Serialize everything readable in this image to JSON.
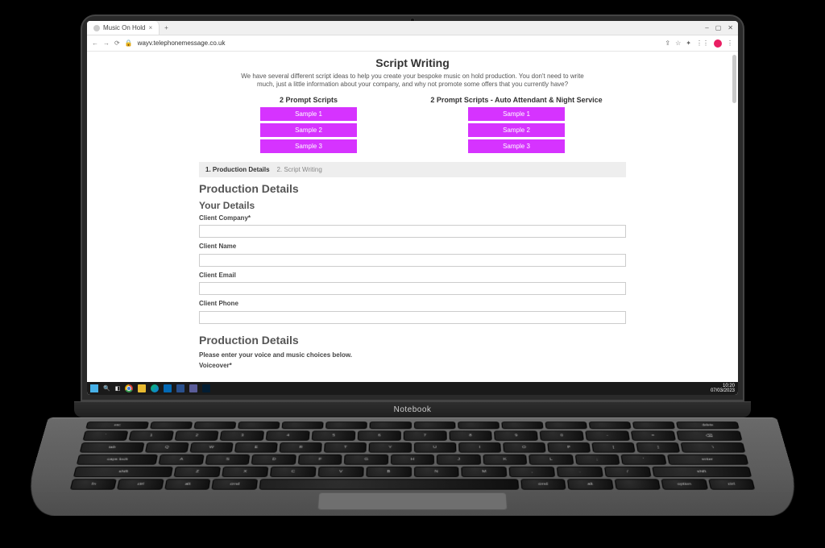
{
  "browser": {
    "tab_title": "Music On Hold",
    "url": "wayv.telephonemessage.co.uk",
    "window_controls": {
      "min": "–",
      "max": "▢",
      "close": "✕"
    }
  },
  "page": {
    "title": "Script Writing",
    "subtitle": "We have several different script ideas to help you create your bespoke music on hold production. You don't need to write much, just a little information about your company, and why not promote some offers that you currently have?",
    "col_left_title": "2 Prompt Scripts",
    "col_right_title": "2 Prompt Scripts - Auto Attendant & Night Service",
    "samples_left": [
      "Sample 1",
      "Sample 2",
      "Sample 3"
    ],
    "samples_right": [
      "Sample 1",
      "Sample 2",
      "Sample 3"
    ],
    "step1": "1. Production Details",
    "step2": "2. Script Writing",
    "h2_production": "Production Details",
    "h3_your_details": "Your Details",
    "label_company": "Client Company*",
    "label_name": "Client Name",
    "label_email": "Client Email",
    "label_phone": "Client Phone",
    "h2_production2": "Production Details",
    "note": "Please enter your voice and music choices below.",
    "label_voiceover": "Voiceover*"
  },
  "taskbar": {
    "time": "10:20",
    "date": "07/03/2023"
  },
  "laptop_brand": "Notebook",
  "keys": {
    "fn": [
      "esc",
      "",
      "",
      "",
      "",
      "",
      "",
      "",
      "",
      "",
      "",
      "",
      "",
      "delete"
    ],
    "num": [
      "`",
      "1",
      "2",
      "3",
      "4",
      "5",
      "6",
      "7",
      "8",
      "9",
      "0",
      "-",
      "=",
      "⌫"
    ],
    "q": [
      "tab",
      "Q",
      "W",
      "E",
      "R",
      "T",
      "Y",
      "U",
      "I",
      "O",
      "P",
      "[",
      "]",
      "\\"
    ],
    "a": [
      "caps lock",
      "A",
      "S",
      "D",
      "F",
      "G",
      "H",
      "J",
      "K",
      "L",
      ";",
      "'",
      "enter"
    ],
    "z": [
      "shift",
      "Z",
      "X",
      "C",
      "V",
      "B",
      "N",
      "M",
      ",",
      ".",
      "/",
      "shift"
    ],
    "sp": [
      "fn",
      "ctrl",
      "alt",
      "cmd",
      "",
      "cmd",
      "alt",
      "",
      "option",
      "ctrl"
    ]
  }
}
